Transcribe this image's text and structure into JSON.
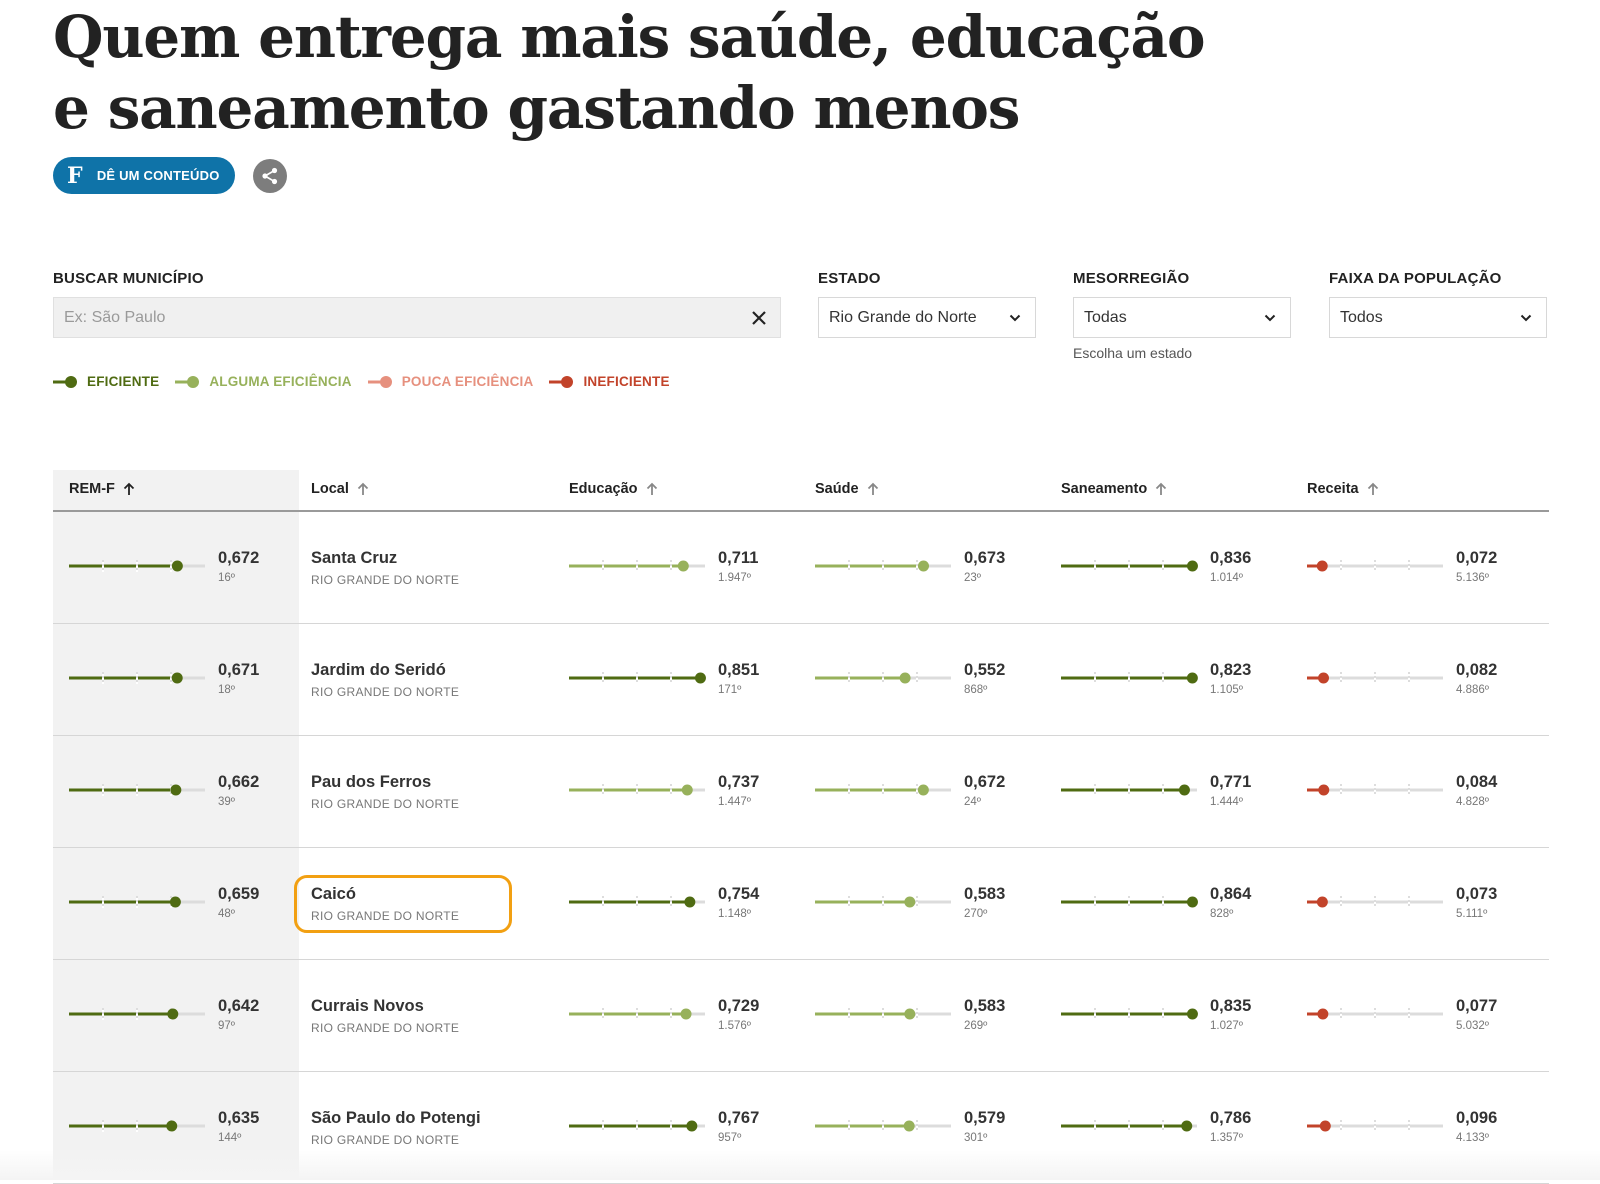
{
  "title_line1": "Quem entrega mais saúde, educação",
  "title_line2": "e saneamento gastando menos",
  "actions": {
    "give_label": "DÊ UM CONTEÚDO",
    "give_logo": "F"
  },
  "filters": {
    "search_label": "BUSCAR MUNICÍPIO",
    "search_placeholder": "Ex: São Paulo",
    "state_label": "ESTADO",
    "state_value": "Rio Grande do Norte",
    "meso_label": "MESORREGIÃO",
    "meso_value": "Todas",
    "meso_hint": "Escolha um estado",
    "pop_label": "FAIXA DA POPULAÇÃO",
    "pop_value": "Todos"
  },
  "colors": {
    "eficiente": "#4f6b12",
    "alguma": "#97b15b",
    "pouca": "#e6907e",
    "ineficiente": "#c2432a",
    "track": "#dcdcdc",
    "highlight": "#f2a012"
  },
  "legend": [
    {
      "label": "EFICIENTE",
      "level": "eficiente"
    },
    {
      "label": "ALGUMA EFICIÊNCIA",
      "level": "alguma"
    },
    {
      "label": "POUCA EFICIÊNCIA",
      "level": "pouca"
    },
    {
      "label": "INEFICIENTE",
      "level": "ineficiente"
    }
  ],
  "columns": [
    "REM-F",
    "Local",
    "Educação",
    "Saúde",
    "Saneamento",
    "Receita"
  ],
  "rows": [
    {
      "name": "Santa Cruz",
      "state": "RIO GRANDE DO NORTE",
      "highlighted": false,
      "metrics": [
        {
          "value": "0,672",
          "rank": "16º",
          "level": "eficiente"
        },
        {
          "value": "0,711",
          "rank": "1.947º",
          "level": "alguma"
        },
        {
          "value": "0,673",
          "rank": "23º",
          "level": "alguma"
        },
        {
          "value": "0,836",
          "rank": "1.014º",
          "level": "eficiente"
        },
        {
          "value": "0,072",
          "rank": "5.136º",
          "level": "ineficiente"
        }
      ]
    },
    {
      "name": "Jardim do Seridó",
      "state": "RIO GRANDE DO NORTE",
      "highlighted": false,
      "metrics": [
        {
          "value": "0,671",
          "rank": "18º",
          "level": "eficiente"
        },
        {
          "value": "0,851",
          "rank": "171º",
          "level": "eficiente"
        },
        {
          "value": "0,552",
          "rank": "868º",
          "level": "alguma"
        },
        {
          "value": "0,823",
          "rank": "1.105º",
          "level": "eficiente"
        },
        {
          "value": "0,082",
          "rank": "4.886º",
          "level": "ineficiente"
        }
      ]
    },
    {
      "name": "Pau dos Ferros",
      "state": "RIO GRANDE DO NORTE",
      "highlighted": false,
      "metrics": [
        {
          "value": "0,662",
          "rank": "39º",
          "level": "eficiente"
        },
        {
          "value": "0,737",
          "rank": "1.447º",
          "level": "alguma"
        },
        {
          "value": "0,672",
          "rank": "24º",
          "level": "alguma"
        },
        {
          "value": "0,771",
          "rank": "1.444º",
          "level": "eficiente"
        },
        {
          "value": "0,084",
          "rank": "4.828º",
          "level": "ineficiente"
        }
      ]
    },
    {
      "name": "Caicó",
      "state": "RIO GRANDE DO NORTE",
      "highlighted": true,
      "metrics": [
        {
          "value": "0,659",
          "rank": "48º",
          "level": "eficiente"
        },
        {
          "value": "0,754",
          "rank": "1.148º",
          "level": "eficiente"
        },
        {
          "value": "0,583",
          "rank": "270º",
          "level": "alguma"
        },
        {
          "value": "0,864",
          "rank": "828º",
          "level": "eficiente"
        },
        {
          "value": "0,073",
          "rank": "5.111º",
          "level": "ineficiente"
        }
      ]
    },
    {
      "name": "Currais Novos",
      "state": "RIO GRANDE DO NORTE",
      "highlighted": false,
      "metrics": [
        {
          "value": "0,642",
          "rank": "97º",
          "level": "eficiente"
        },
        {
          "value": "0,729",
          "rank": "1.576º",
          "level": "alguma"
        },
        {
          "value": "0,583",
          "rank": "269º",
          "level": "alguma"
        },
        {
          "value": "0,835",
          "rank": "1.027º",
          "level": "eficiente"
        },
        {
          "value": "0,077",
          "rank": "5.032º",
          "level": "ineficiente"
        }
      ]
    },
    {
      "name": "São Paulo do Potengi",
      "state": "RIO GRANDE DO NORTE",
      "highlighted": false,
      "metrics": [
        {
          "value": "0,635",
          "rank": "144º",
          "level": "eficiente"
        },
        {
          "value": "0,767",
          "rank": "957º",
          "level": "eficiente"
        },
        {
          "value": "0,579",
          "rank": "301º",
          "level": "alguma"
        },
        {
          "value": "0,786",
          "rank": "1.357º",
          "level": "eficiente"
        },
        {
          "value": "0,096",
          "rank": "4.133º",
          "level": "ineficiente"
        }
      ]
    }
  ]
}
